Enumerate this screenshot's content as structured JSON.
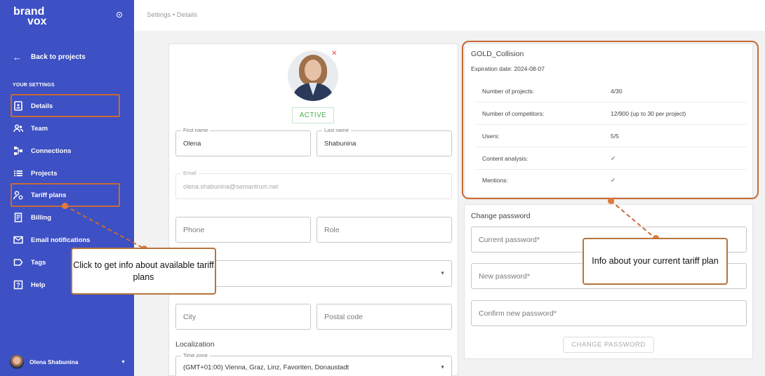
{
  "sidebar": {
    "logo_line1": "brand",
    "logo_line2": "vox",
    "back_label": "Back to projects",
    "section_label": "YOUR SETTINGS",
    "items": [
      {
        "label": "Details",
        "icon": "details-icon"
      },
      {
        "label": "Team",
        "icon": "team-icon"
      },
      {
        "label": "Connections",
        "icon": "connections-icon"
      },
      {
        "label": "Projects",
        "icon": "list-icon"
      },
      {
        "label": "Tariff plans",
        "icon": "tariff-icon"
      },
      {
        "label": "Billing",
        "icon": "billing-icon"
      },
      {
        "label": "Email notifications",
        "icon": "mail-icon"
      },
      {
        "label": "Tags",
        "icon": "tag-icon"
      },
      {
        "label": "Help",
        "icon": "help-icon"
      }
    ],
    "user_name": "Olena Shabunina"
  },
  "breadcrumb": "Settings • Details",
  "profile": {
    "status": "ACTIVE",
    "first_name_label": "First name",
    "first_name": "Olena",
    "last_name_label": "Last name",
    "last_name": "Shabunina",
    "email_label": "Email",
    "email": "olena.shabunina@semantrum.net",
    "phone_placeholder": "Phone",
    "role_placeholder": "Role",
    "city_placeholder": "City",
    "postal_placeholder": "Postal code",
    "localization_title": "Localization",
    "timezone_label": "Time zone",
    "timezone": "(GMT+01:00) Vienna, Graz, Linz, Favoriten, Donaustadt"
  },
  "plan": {
    "name": "GOLD_Collision",
    "expiration_label": "Expiration date:",
    "expiration_date": "2024-08-07",
    "rows": [
      {
        "key": "Number of projects:",
        "value": "4/30"
      },
      {
        "key": "Number of competitors:",
        "value": "12/900 (up to 30 per project)"
      },
      {
        "key": "Users:",
        "value": "5/5"
      },
      {
        "key": "Content analysis:",
        "value": "✓"
      },
      {
        "key": "Mentions:",
        "value": "✓"
      }
    ]
  },
  "password": {
    "title": "Change password",
    "current_placeholder": "Current password*",
    "new_placeholder": "New password*",
    "confirm_placeholder": "Confirm new password*",
    "button": "CHANGE PASSWORD"
  },
  "annotations": {
    "left": "Click to get info about available tariff plans",
    "right": "Info about your current tariff plan"
  },
  "colors": {
    "sidebar": "#3d50c4",
    "annotation": "#c76b36",
    "active": "#4caf50"
  }
}
